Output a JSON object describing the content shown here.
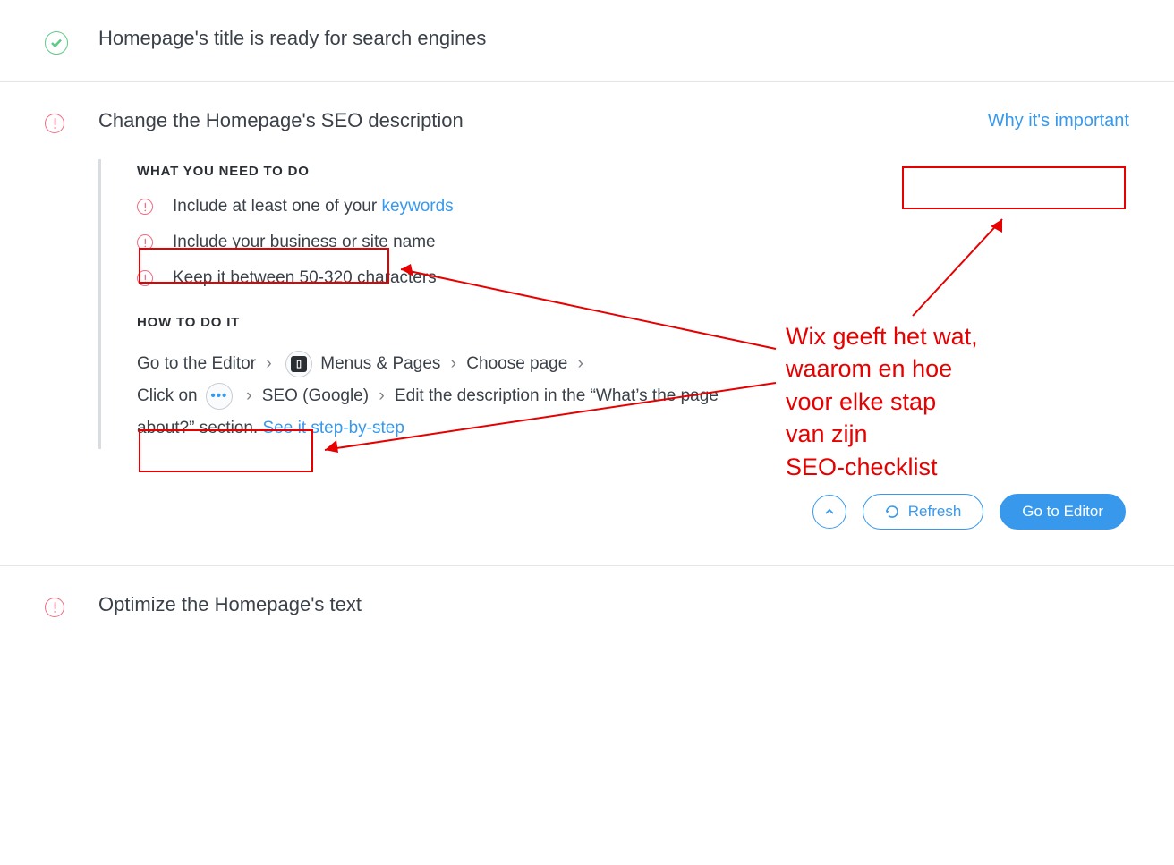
{
  "steps": {
    "title_ready": "Homepage's title is ready for search engines",
    "change_desc": "Change the Homepage's SEO description",
    "optimize_text": "Optimize the Homepage's text"
  },
  "links": {
    "why_important": "Why it's important",
    "keywords": "keywords",
    "see_step_by_step": "See it step-by-step"
  },
  "sections": {
    "what_to_do": "WHAT YOU NEED TO DO",
    "how_to_do_it": "HOW TO DO IT"
  },
  "needs": [
    {
      "prefix": "Include at least one of your ",
      "link": "keywords",
      "suffix": ""
    },
    {
      "prefix": "Include your business or site name",
      "link": "",
      "suffix": ""
    },
    {
      "prefix": "Keep it between 50-320 characters",
      "link": "",
      "suffix": ""
    }
  ],
  "how": {
    "go_editor": "Go to the Editor",
    "menus_pages": "Menus & Pages",
    "choose_page": "Choose page",
    "click_on": "Click on",
    "seo_google": "SEO (Google)",
    "edit_desc": "Edit the description in the “What’s the page about?” section."
  },
  "buttons": {
    "refresh": "Refresh",
    "go_editor": "Go to Editor"
  },
  "annotation": {
    "text": "Wix geeft het wat,\nwaarom en hoe\nvoor elke stap\nvan zijn\nSEO-checklist"
  }
}
